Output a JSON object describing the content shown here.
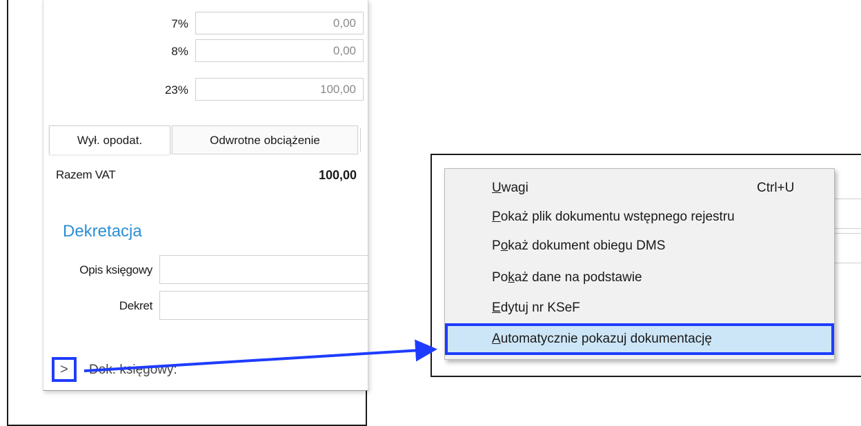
{
  "vat_rates": [
    {
      "rate": "7%",
      "value": "0,00"
    },
    {
      "rate": "8%",
      "value": "0,00"
    },
    {
      "rate": "23%",
      "value": "100,00"
    }
  ],
  "tabs": [
    {
      "label": "Wył. opodat.",
      "active": true
    },
    {
      "label": "Odwrotne obciążenie",
      "active": false
    }
  ],
  "razem_vat": {
    "label": "Razem VAT",
    "value": "100,00"
  },
  "dekretacja": {
    "title": "Dekretacja",
    "opis_label": "Opis księgowy",
    "dekret_label": "Dekret"
  },
  "footer": {
    "expander_glyph": ">",
    "dok_label": "Dok. księgowy:"
  },
  "context_menu": {
    "items": [
      {
        "pre": "",
        "ul": "U",
        "post": "wagi",
        "shortcut": "Ctrl+U"
      },
      {
        "pre": "",
        "ul": "P",
        "post": "okaż plik dokumentu wstępnego rejestru",
        "shortcut": ""
      },
      {
        "pre": "P",
        "ul": "o",
        "post": "każ dokument obiegu DMS",
        "shortcut": ""
      },
      {
        "pre": "Po",
        "ul": "k",
        "post": "aż dane na podstawie",
        "shortcut": ""
      },
      {
        "pre": "",
        "ul": "E",
        "post": "dytuj nr KSeF",
        "shortcut": ""
      },
      {
        "pre": "",
        "ul": "A",
        "post": "utomatycznie pokazuj dokumentację",
        "shortcut": "",
        "highlighted": true
      }
    ]
  },
  "colors": {
    "accent_title": "#2b8fd6",
    "annotation_blue": "#1e3cff",
    "menu_highlight": "#cde6f7",
    "menu_bg": "#f1f1f1"
  }
}
